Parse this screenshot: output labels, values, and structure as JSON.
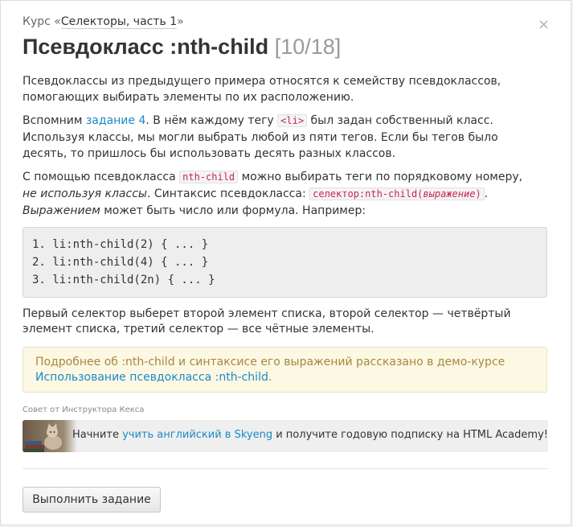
{
  "breadcrumb": {
    "prefix": "Курс «",
    "course": "Селекторы, часть 1",
    "suffix": "»"
  },
  "close_symbol": "×",
  "title": {
    "text": "Псевдокласс :nth-child",
    "counter": "[10/18]"
  },
  "para1": "Псевдоклассы из предыдущего примера относятся к семейству псевдоклассов, помогающих выбирать элементы по их расположению.",
  "para2": {
    "t1": "Вспомним ",
    "link": "задание 4",
    "t2": ". В нём каждому тегу ",
    "code": "<li>",
    "t3": " был задан собственный класс. Используя классы, мы могли выбрать любой из пяти тегов. Если бы тегов было десять, то пришлось бы использовать десять разных классов."
  },
  "para3": {
    "t1": "С помощью псевдокласса ",
    "code1": "nth-child",
    "t2": " можно выбирать теги по порядковому номеру,",
    "em1": "не используя классы",
    "t3": ". Синтаксис псевдокласса: ",
    "code2a": "селектор:nth-child(",
    "code2em": "выражение",
    "code2b": ")",
    "t4": ".",
    "em2": "Выражением",
    "t5": " может быть число или формула. Например:"
  },
  "code_lines": [
    "1. li:nth-child(2) { ... }",
    "2. li:nth-child(4) { ... }",
    "3. li:nth-child(2n) { ... }"
  ],
  "para4": "Первый селектор выберет второй элемент списка, второй селектор — четвёртый элемент списка, третий селектор — все чётные элементы.",
  "note": {
    "text": "Подробнее об :nth-child и синтаксисе его выражений рассказано в демо-курсе",
    "link": "Использование псевдокласса :nth-child",
    "end": "."
  },
  "tip_label": "Совет от Инструктора Кекса",
  "promo": {
    "t1": "Начните ",
    "link": "учить английский в Skyeng",
    "t2": " и получите годовую подписку на HTML Academy!"
  },
  "button": "Выполнить задание"
}
